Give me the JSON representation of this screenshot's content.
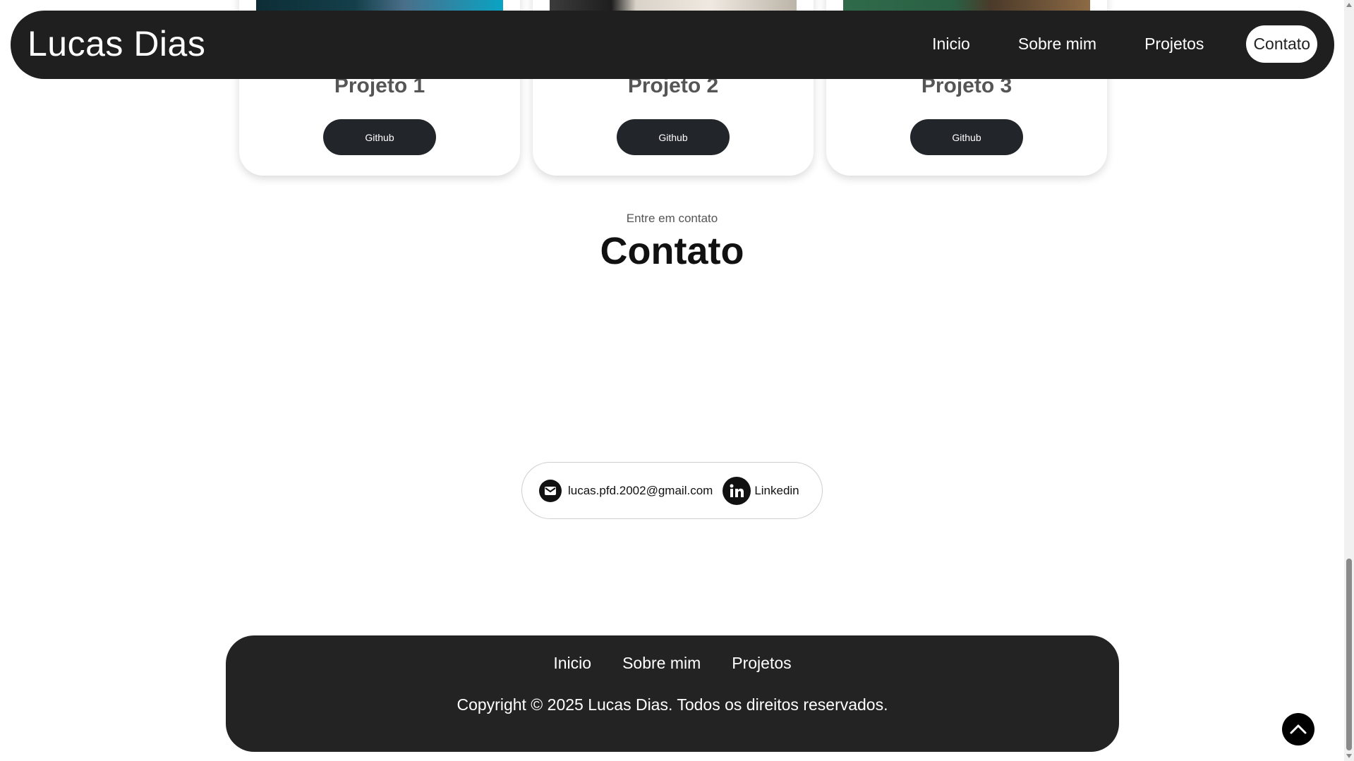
{
  "header": {
    "brand": "Lucas Dias",
    "nav": [
      "Inicio",
      "Sobre mim",
      "Projetos",
      "Contato"
    ],
    "active": "Contato"
  },
  "projects": [
    {
      "title": "Projeto 1",
      "button": "Github"
    },
    {
      "title": "Projeto 2",
      "button": "Github"
    },
    {
      "title": "Projeto 3",
      "button": "Github"
    }
  ],
  "contact": {
    "subtitle": "Entre em contato",
    "title": "Contato",
    "email": "lucas.pfd.2002@gmail.com",
    "linkedin": "Linkedin",
    "email_icon": "mail-icon",
    "linkedin_icon": "linkedin-icon"
  },
  "footer": {
    "links": [
      "Inicio",
      "Sobre mim",
      "Projetos"
    ],
    "copyright": "Copyright © 2025 Lucas Dias. Todos os direitos reservados."
  },
  "back_to_top_icon": "chevron-up-icon"
}
